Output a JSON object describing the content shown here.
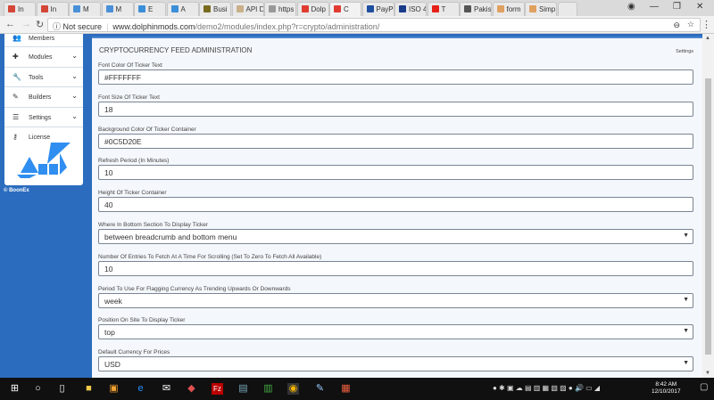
{
  "browser": {
    "tabs": [
      {
        "label": "In",
        "icon": "gmail-icon",
        "color": "#d44638"
      },
      {
        "label": "In",
        "icon": "gmail-icon",
        "color": "#d44638"
      },
      {
        "label": "M",
        "icon": "site-icon",
        "color": "#4a90d9"
      },
      {
        "label": "M",
        "icon": "site-icon",
        "color": "#4a90d9"
      },
      {
        "label": "E",
        "icon": "link-icon",
        "color": "#3b8fd8"
      },
      {
        "label": "A",
        "icon": "link-icon",
        "color": "#3b8fd8"
      },
      {
        "label": "Busi",
        "icon": "site-icon",
        "color": "#7a6a20"
      },
      {
        "label": "API D",
        "icon": "site-icon",
        "color": "#c9b08a"
      },
      {
        "label": "https",
        "icon": "page-icon",
        "color": "#999999"
      },
      {
        "label": "Dolp",
        "icon": "dolphin-icon",
        "color": "#e03c31"
      },
      {
        "label": "C",
        "icon": "dolphin-icon",
        "color": "#e03c31",
        "active": true
      },
      {
        "label": "PayP",
        "icon": "paypal-icon",
        "color": "#1f4fa0"
      },
      {
        "label": "ISO 4",
        "icon": "xe-icon",
        "color": "#1a3a8a"
      },
      {
        "label": "T",
        "icon": "youtube-icon",
        "color": "#e62117"
      },
      {
        "label": "Pakis",
        "icon": "wikipedia-icon",
        "color": "#555555"
      },
      {
        "label": "form",
        "icon": "site-icon",
        "color": "#e0a060"
      },
      {
        "label": "Simp",
        "icon": "site-icon",
        "color": "#e0a060"
      }
    ],
    "security": "Not secure",
    "url_host": "www.dolphinmods.com",
    "url_path": "/demo2/modules/index.php?r=crypto/administration/"
  },
  "sidebar": {
    "items": [
      {
        "label": "Members",
        "icon": "members-icon",
        "glyph": "👥"
      },
      {
        "label": "Modules",
        "icon": "modules-icon",
        "glyph": "✚",
        "chev": true
      },
      {
        "label": "Tools",
        "icon": "wrench-icon",
        "glyph": "🔧",
        "chev": true
      },
      {
        "label": "Builders",
        "icon": "wand-icon",
        "glyph": "✎",
        "chev": true
      },
      {
        "label": "Settings",
        "icon": "sliders-icon",
        "glyph": "☰",
        "chev": true
      },
      {
        "label": "License",
        "icon": "key-icon",
        "glyph": "⚷"
      }
    ],
    "footer": "© BoonEx"
  },
  "main": {
    "title": "CRYPTOCURRENCY FEED ADMINISTRATION",
    "settings_link": "Settings",
    "fields": [
      {
        "label": "Font Color Of Ticker Text",
        "value": "#FFFFFFF",
        "type": "text"
      },
      {
        "label": "Font Size Of Ticker Text",
        "value": "18",
        "type": "text"
      },
      {
        "label": "Background Color Of Ticker Container",
        "value": "#0C5D20E",
        "type": "text"
      },
      {
        "label": "Refresh Period (In Minutes)",
        "value": "10",
        "type": "text"
      },
      {
        "label": "Height Of Ticker Container",
        "value": "40",
        "type": "text"
      },
      {
        "label": "Where In Bottom Section To Display Ticker",
        "value": "between breadcrumb and bottom menu",
        "type": "select"
      },
      {
        "label": "Number Of Entries To Fetch At A Time For Scrolling (Set To Zero To Fetch All Available)",
        "value": "10",
        "type": "text"
      },
      {
        "label": "Period To Use For Flagging Currency As Trending Upwards Or Downwards",
        "value": "week",
        "type": "select"
      },
      {
        "label": "Position On Site To Display Ticker",
        "value": "top",
        "type": "select"
      },
      {
        "label": "Default Currency For Prices",
        "value": "USD",
        "type": "select"
      }
    ]
  },
  "taskbar": {
    "time": "8:42 AM",
    "date": "12/10/2017"
  }
}
